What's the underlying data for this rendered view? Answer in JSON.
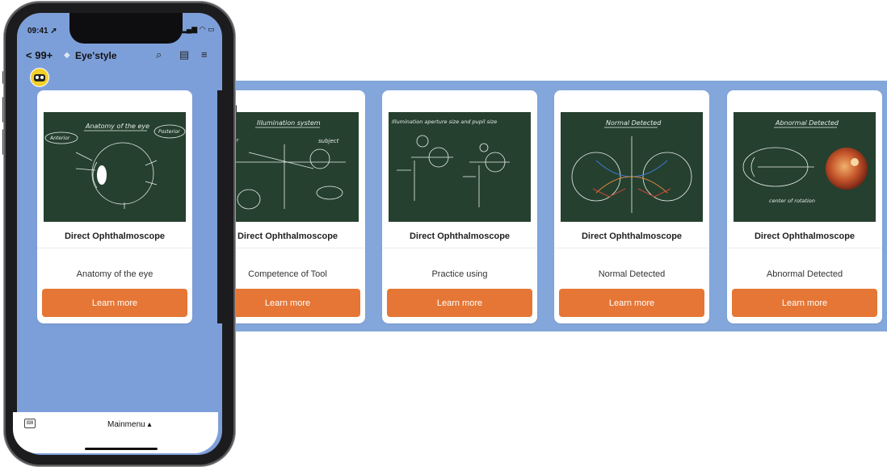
{
  "status": {
    "time": "09:41"
  },
  "nav": {
    "back_label": "99+",
    "title": "Eye'style"
  },
  "cards": [
    {
      "title": "Direct Ophthalmoscope",
      "subtitle": "Anatomy of the eye",
      "button": "Learn more",
      "image_heading": "Anatomy of the eye",
      "image_labels": [
        "Anterior",
        "Posterior"
      ]
    },
    {
      "title": "Direct Ophthalmoscope",
      "subtitle": "Competence of Tool",
      "button": "Learn more",
      "image_heading": "Illumination system",
      "image_labels": [
        "server",
        "subject"
      ]
    },
    {
      "title": "Direct Ophthalmoscope",
      "subtitle": "Practice using",
      "button": "Learn more",
      "image_heading": "Illumination aperture size and pupil size"
    },
    {
      "title": "Direct Ophthalmoscope",
      "subtitle": "Normal Detected",
      "button": "Learn more",
      "image_heading": "Normal Detected"
    },
    {
      "title": "Direct Ophthalmoscope",
      "subtitle": "Abnormal Detected",
      "button": "Learn more",
      "image_heading": "Abnormal Detected",
      "image_labels": [
        "center of rotation"
      ]
    }
  ],
  "bottom": {
    "menu_label": "Mainmenu ▴"
  },
  "colors": {
    "screen_bg": "#7d9fd9",
    "strip_bg": "#84a7db",
    "button": "#e57635",
    "chalkboard": "#26402f"
  }
}
